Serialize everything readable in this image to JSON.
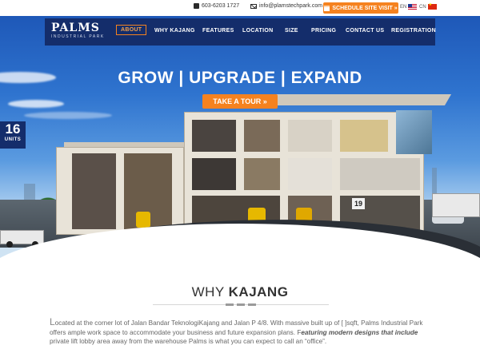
{
  "topbar": {
    "phone": "603-6203 1727",
    "email": "info@plamstechpark.com",
    "schedule_label": "SCHEDULE SITE VISIT »",
    "lang_en": "EN",
    "lang_cn": "CN"
  },
  "logo": {
    "main": "PALMS",
    "sub": "INDUSTRIAL PARK"
  },
  "nav": {
    "items": [
      {
        "label": "ABOUT",
        "active": true
      },
      {
        "label": "WHY KAJANG"
      },
      {
        "label": "FEATURES"
      },
      {
        "label": "LOCATION"
      },
      {
        "label": "SIZE"
      },
      {
        "label": "PRICING"
      },
      {
        "label": "CONTACT US"
      },
      {
        "label": "REGISTRATION"
      }
    ]
  },
  "hero": {
    "title": "GROW | UPGRADE | EXPAND",
    "tour_label": "TAKE A TOUR »",
    "units_number": "16",
    "units_label": "UNITS",
    "sign_number": "19"
  },
  "section": {
    "title_light": "WHY ",
    "title_bold": "KAJANG",
    "body_dropcap": "L",
    "body_part1": "ocated at the corner lot of Jalan Bandar TeknologiKajang and Jalan P 4/8. With massive built up of [ ]sqft, Palms Industrial Park offers ample work space to accommodate your business and future expansion plans. F",
    "body_emphasis": "eaturing modern designs that include",
    "body_part2": " private lift lobby area away from the warehouse Palms is what you can expect to call an “office”."
  },
  "colors": {
    "navy": "#142d6b",
    "orange": "#f5821f"
  },
  "icons": [
    "phone-icon",
    "mail-icon",
    "calendar-icon",
    "flag-us-icon",
    "flag-cn-icon"
  ]
}
